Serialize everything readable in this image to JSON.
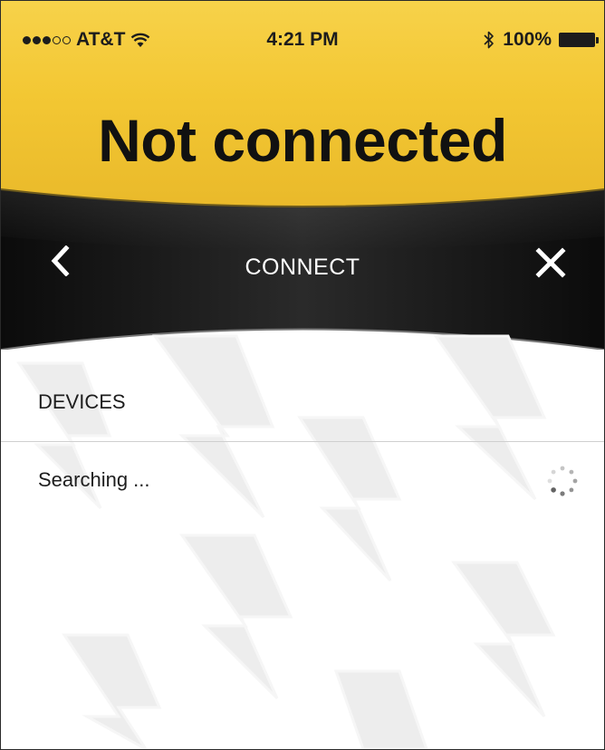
{
  "status_bar": {
    "carrier": "AT&T",
    "time": "4:21 PM",
    "battery": "100%",
    "signal_bars_filled": 3,
    "signal_bars_total": 5
  },
  "header": {
    "title": "Not connected"
  },
  "nav": {
    "title": "CONNECT",
    "back_icon": "chevron-left-icon",
    "close_icon": "close-icon"
  },
  "devices": {
    "section_label": "DEVICES",
    "status_text": "Searching ...",
    "spinner_icon": "loading-spinner-icon"
  },
  "colors": {
    "header_yellow": "#f3c733",
    "nav_black": "#161616",
    "background": "#ffffff",
    "text_dark": "#1d1d1d"
  }
}
